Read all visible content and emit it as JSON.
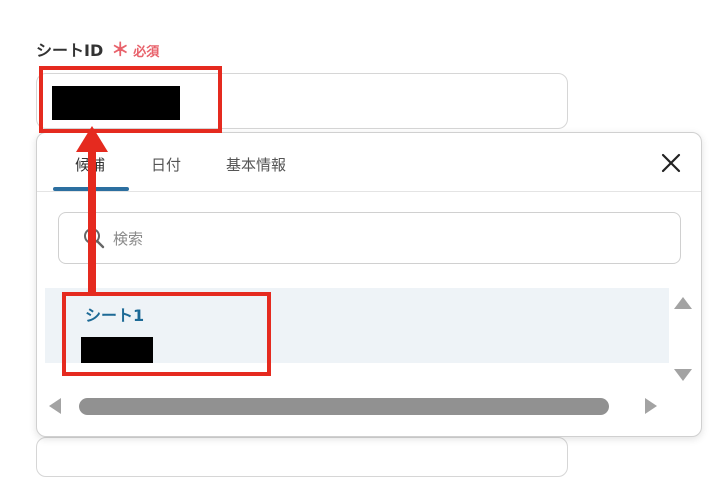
{
  "field": {
    "label": "シートID",
    "required_mark": "＊",
    "required_text": "必須"
  },
  "popup": {
    "tabs": [
      {
        "label": "候補",
        "active": true
      },
      {
        "label": "日付",
        "active": false
      },
      {
        "label": "基本情報",
        "active": false
      }
    ],
    "close_icon": "close-icon",
    "search": {
      "placeholder": "検索",
      "value": "",
      "icon": "search-icon"
    },
    "items": [
      {
        "title": "シート1"
      }
    ]
  },
  "colors": {
    "required": "#e8626b",
    "accent": "#2c6fa0",
    "item_title": "#1d6a96",
    "annotation": "#e52a1f"
  }
}
